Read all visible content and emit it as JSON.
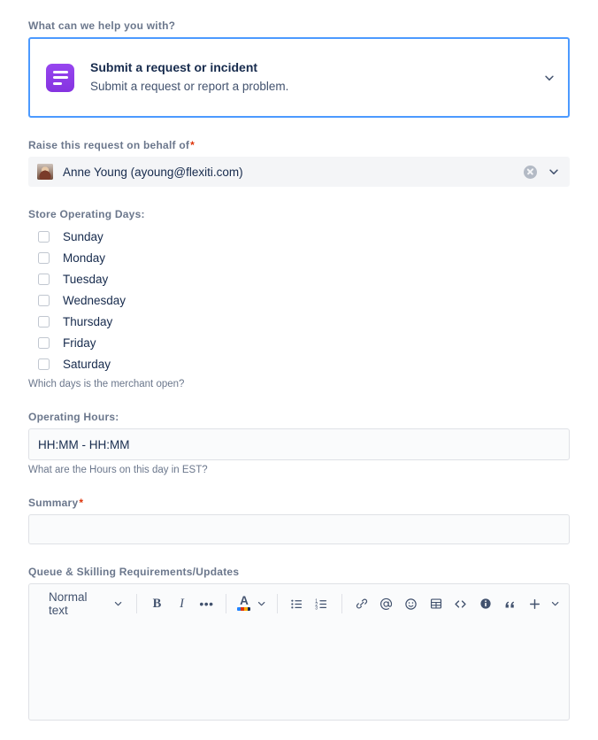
{
  "form": {
    "request_type": {
      "label": "What can we help you with?",
      "icon": "request-type-icon",
      "title": "Submit a request or incident",
      "description": "Submit a request or report a problem.",
      "chevron_icon": "chevron-down-icon",
      "border_color": "#4C9AFF",
      "icon_color": "#8B3FE8"
    },
    "on_behalf_of": {
      "label": "Raise this request on behalf of",
      "required_marker": "*",
      "value": "Anne Young (ayoung@flexiti.com)",
      "avatar_icon": "user-avatar",
      "clear_icon": "clear-icon",
      "chevron_icon": "chevron-down-icon"
    },
    "operating_days": {
      "label": "Store Operating Days:",
      "helper": "Which days is the merchant open?",
      "options": [
        {
          "label": "Sunday",
          "checked": false
        },
        {
          "label": "Monday",
          "checked": false
        },
        {
          "label": "Tuesday",
          "checked": false
        },
        {
          "label": "Wednesday",
          "checked": false
        },
        {
          "label": "Thursday",
          "checked": false
        },
        {
          "label": "Friday",
          "checked": false
        },
        {
          "label": "Saturday",
          "checked": false
        }
      ]
    },
    "operating_hours": {
      "label": "Operating Hours:",
      "value": "HH:MM - HH:MM",
      "helper": "What are the Hours on this day in EST?"
    },
    "summary": {
      "label": "Summary",
      "required_marker": "*",
      "value": ""
    },
    "queue_skilling": {
      "label": "Queue & Skilling Requirements/Updates",
      "value": "",
      "toolbar": {
        "text_style": "Normal text",
        "style_chevron_icon": "chevron-down-icon",
        "bold_label": "B",
        "italic_label": "I",
        "more_label": "•••",
        "text_color_label": "A",
        "text_color_chevron_icon": "chevron-down-icon",
        "text_color_swatch": [
          "#2684FF",
          "#DE350B",
          "#FFAB00",
          "#172B4D"
        ],
        "bullet_list_icon": "bullet-list-icon",
        "numbered_list_icon": "numbered-list-icon",
        "link_icon": "link-icon",
        "mention_icon": "mention-icon",
        "emoji_icon": "emoji-icon",
        "table_icon": "table-icon",
        "code_icon": "code-icon",
        "info_icon": "info-panel-icon",
        "quote_icon": "quote-icon",
        "plus_icon": "insert-more-icon",
        "plus_chevron_icon": "chevron-down-icon"
      }
    }
  }
}
